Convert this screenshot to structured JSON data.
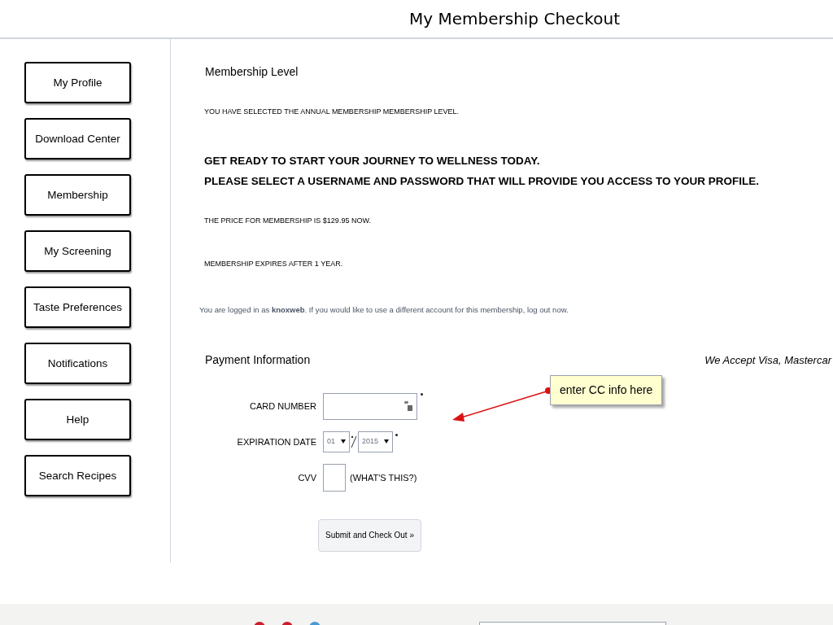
{
  "header": {
    "title": "My Membership Checkout"
  },
  "sidebar": {
    "items": [
      {
        "label": "My Profile"
      },
      {
        "label": "Download Center"
      },
      {
        "label": "Membership"
      },
      {
        "label": "My Screening"
      },
      {
        "label": "Taste Preferences"
      },
      {
        "label": "Notifications"
      },
      {
        "label": "Help"
      },
      {
        "label": "Search Recipes"
      }
    ]
  },
  "membership": {
    "heading": "Membership Level",
    "selected_text": "YOU HAVE SELECTED THE ANNUAL MEMBERSHIP MEMBERSHIP LEVEL.",
    "headline": [
      "GET READY TO START YOUR JOURNEY TO WELLNESS TODAY.",
      "PLEASE SELECT A USERNAME AND PASSWORD THAT WILL PROVIDE YOU ACCESS TO YOUR PROFILE."
    ],
    "price_text": "THE PRICE FOR MEMBERSHIP IS $129.95 NOW.",
    "expiry_text": "MEMBERSHIP EXPIRES AFTER 1 YEAR.",
    "login_text": "You are logged in as **knoxweb**. If you would like to use a different account for this membership,",
    "logout_link": "log out now."
  },
  "payment": {
    "heading": "Payment Information",
    "accepted": "We Accept Visa, Mastercar",
    "card_label": "CARD NUMBER",
    "expiry_label": "EXPIRATION DATE",
    "month": "01",
    "year": "2015",
    "cvv_label": "CVV",
    "cvv_help": "(WHAT'S THIS?)",
    "submit": "Submit and Check Out »"
  },
  "annotation": {
    "text": "enter CC info here"
  }
}
